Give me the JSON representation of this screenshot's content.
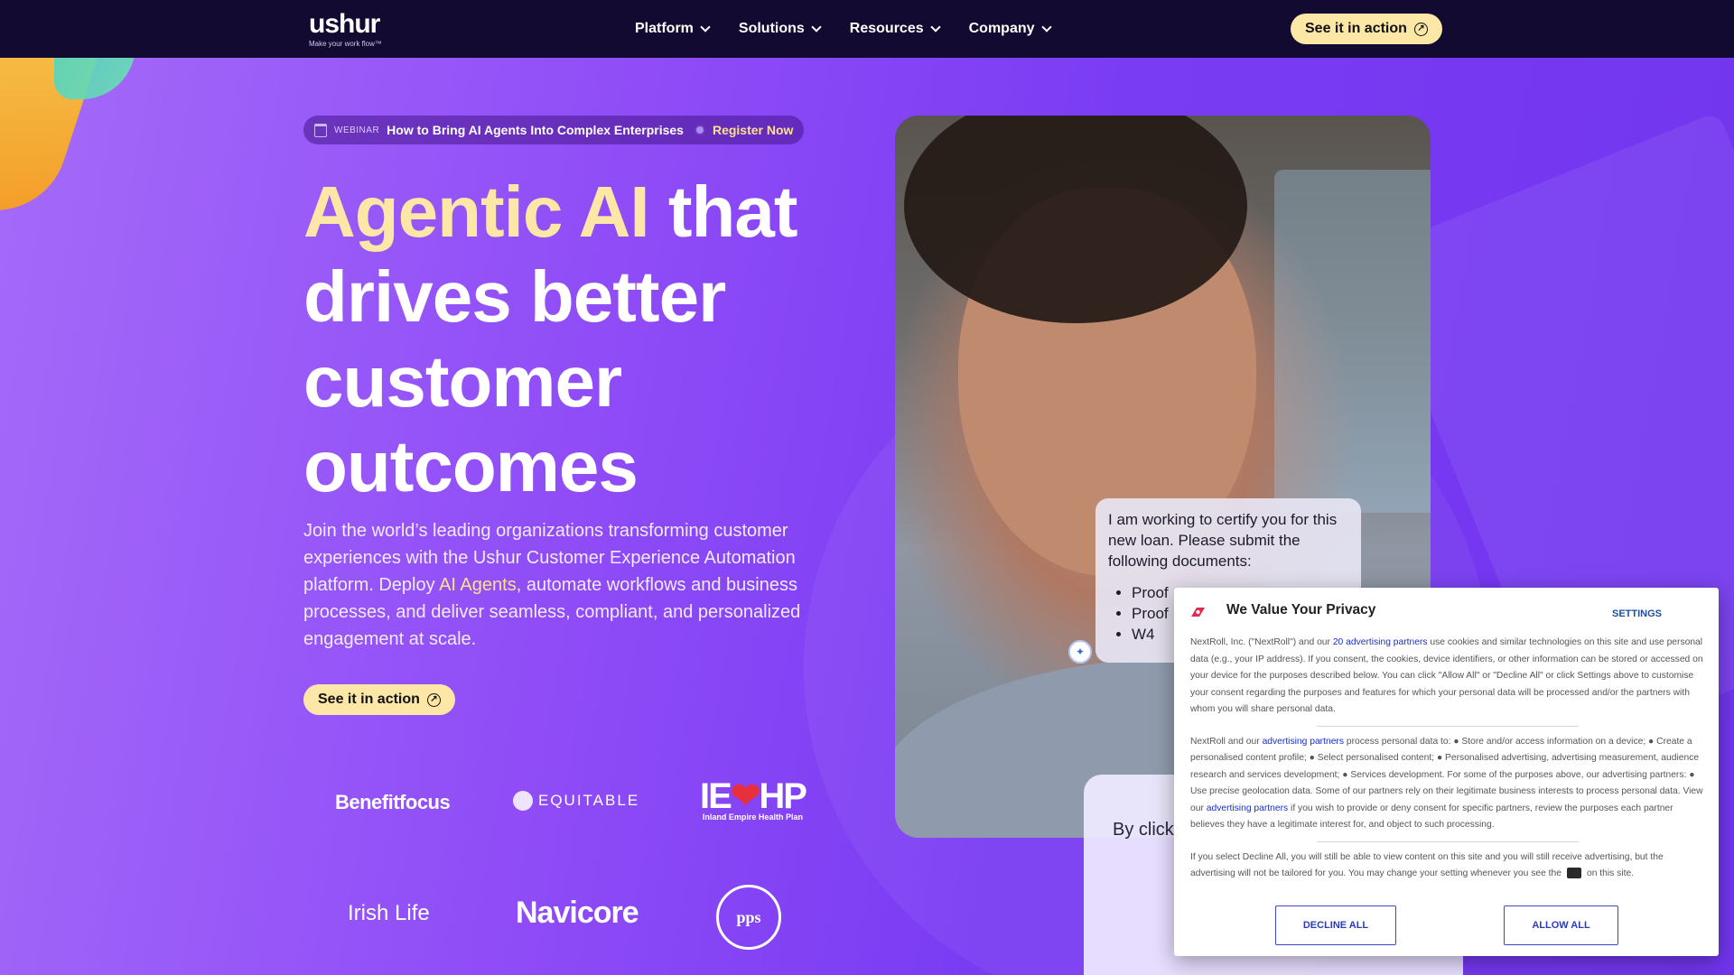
{
  "nav": {
    "logo_word": "ushur",
    "logo_tagline": "Make your work flow™",
    "items": [
      "Platform",
      "Solutions",
      "Resources",
      "Company"
    ],
    "cta": "See it in action"
  },
  "webinar": {
    "label": "WEBINAR",
    "title": "How to Bring AI Agents Into Complex Enterprises",
    "link": "Register Now"
  },
  "hero": {
    "headline_highlight": "Agentic AI",
    "headline_rest_1": " that",
    "headline_rest_2": "drives better customer outcomes",
    "lead_1": "Join the world’s leading organizations transforming customer experiences with the Ushur Customer Experience Automation platform. Deploy ",
    "lead_link": "AI Agents",
    "lead_2": ", automate workflows and business processes, and deliver seamless, compliant, and personalized engagement at scale.",
    "cta": "See it in action"
  },
  "logos": {
    "benefitfocus": "Benefitfocus",
    "equitable": "EQUITABLE",
    "iehp_main_1": "IE",
    "iehp_heart": "❤",
    "iehp_main_2": "HP",
    "iehp_sub": "Inland Empire Health Plan",
    "irishlife": "Irish Life",
    "navicore": "Navicore",
    "pps": "pps"
  },
  "chat": {
    "message": "I am working to certify you for this new loan. Please submit the following documents:",
    "items": [
      "Proof",
      "Proof",
      "W4"
    ]
  },
  "lower_card": {
    "text": "By click to enha efforts. Y"
  },
  "consent": {
    "title": "We Value Your Privacy",
    "settings": "SETTINGS",
    "p1_a": "NextRoll, Inc. (\"NextRoll\") and our ",
    "p1_link": "20 advertising partners",
    "p1_b": " use cookies and similar technologies on this site and use personal data (e.g., your IP address). If you consent, the cookies, device identifiers, or other information can be stored or accessed on your device for the purposes described below. You can click \"Allow All\" or \"Decline All\" or click Settings above to customise your consent regarding the purposes and features for which your personal data will be processed and/or the partners with whom you will share personal data.",
    "p2_a": "NextRoll and our ",
    "p2_link1": "advertising partners",
    "p2_b": " process personal data to: ● Store and/or access information on a device; ● Create a personalised content profile; ● Select personalised content; ● Personalised advertising, advertising measurement, audience research and services development; ● Services development. For some of the purposes above, our advertising partners: ● Use precise geolocation data. Some of our partners rely on their legitimate business interests to process personal data. View our ",
    "p2_link2": "advertising partners",
    "p2_c": " if you wish to provide or deny consent for specific partners, review the purposes each partner believes they have a legitimate interest for, and object to such processing.",
    "p3_a": "If you select Decline All, you will still be able to view content on this site and you will still receive advertising, but the advertising will not be tailored for you. You may change your setting whenever you see the",
    "p3_b": "on this site.",
    "decline": "DECLINE ALL",
    "allow": "ALLOW ALL"
  },
  "colors": {
    "nav_bg": "#120a31",
    "accent_yellow": "#fde7a6",
    "hero_purple": "#7b3af2",
    "link_blue": "#1a2fc7"
  }
}
